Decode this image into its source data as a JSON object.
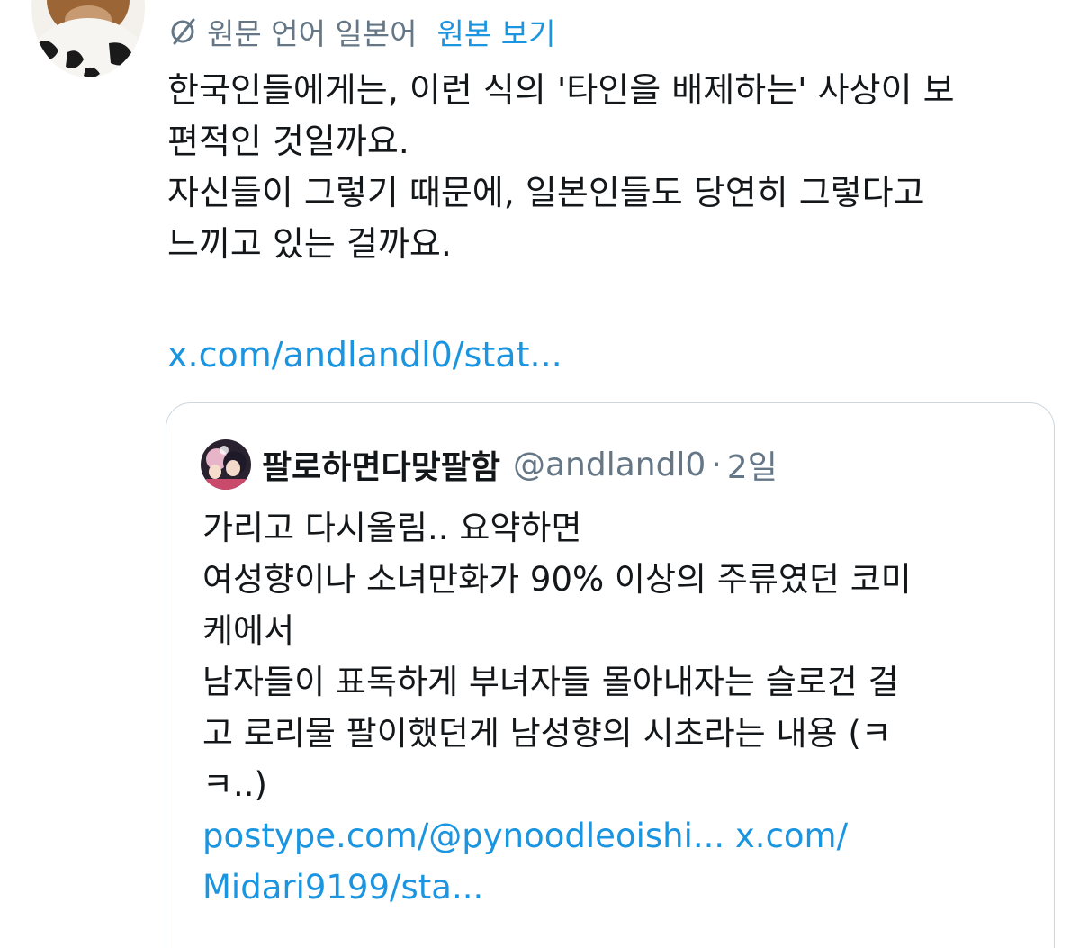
{
  "tweet": {
    "translation_bar": {
      "icon": "globe-icon",
      "label": "원문 언어 일본어",
      "view_original": "원본 보기"
    },
    "text_lines": [
      "한국인들에게는, 이런 식의 '타인을 배제하는' 사상이 보",
      "편적인 것일까요.",
      "자신들이 그렇기 때문에, 일본인들도 당연히 그렇다고",
      "느끼고 있는 걸까요."
    ],
    "link": "x.com/andlandl0/stat..."
  },
  "quote": {
    "author_name": "팔로하면다맞팔함",
    "handle": "@andlandl0",
    "separator": "·",
    "time": "2일",
    "text_lines": [
      "가리고 다시올림.. 요약하면",
      "여성향이나 소녀만화가 90% 이상의 주류였던 코미",
      "케에서",
      "남자들이 표독하게 부녀자들 몰아내자는 슬로건 걸",
      "고 로리물 팔이했던게 남성향의 시초라는 내용 (ㅋ",
      "ㅋ..)"
    ],
    "links_line1": "postype.com/@pynoodleoishi... x.com/",
    "links_line2": "Midari9199/sta..."
  },
  "colors": {
    "link": "#1b95e0",
    "secondary_text": "#657786",
    "primary_text": "#14171a",
    "card_border": "#ccd6dd"
  }
}
